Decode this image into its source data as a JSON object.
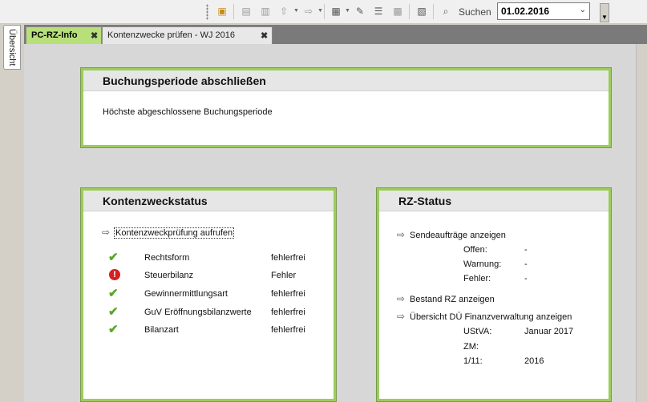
{
  "toolbar": {
    "search_label": "Suchen",
    "date_value": "01.02.2016",
    "icons": [
      "folder-icon",
      "print-preview-icon",
      "print-icon",
      "upload-arrow-icon",
      "forward-arrow-icon",
      "export-icon",
      "wrench-icon",
      "list-indent-icon",
      "stamp-icon",
      "pdf-icon",
      "search-icon"
    ]
  },
  "side_tab": {
    "label": "Übersicht"
  },
  "tabs": [
    {
      "label": "PC-RZ-Info",
      "close": "✖"
    },
    {
      "label": "Kontenzwecke prüfen - WJ 2016",
      "close": "✖"
    }
  ],
  "panels": {
    "buchung": {
      "title": "Buchungsperiode abschließen",
      "text": "Höchste abgeschlossene Buchungsperiode"
    },
    "konten": {
      "title": "Kontenzweckstatus",
      "link": "Kontenzweckprüfung aufrufen",
      "rows": [
        {
          "name": "Rechtsform",
          "status": "fehlerfrei",
          "icon": "check-icon"
        },
        {
          "name": "Steuerbilanz",
          "status": "Fehler",
          "icon": "error-icon"
        },
        {
          "name": "Gewinnermittlungsart",
          "status": "fehlerfrei",
          "icon": "check-icon"
        },
        {
          "name": "GuV Eröffnungsbilanzwerte",
          "status": "fehlerfrei",
          "icon": "check-icon"
        },
        {
          "name": "Bilanzart",
          "status": "fehlerfrei",
          "icon": "check-icon"
        }
      ]
    },
    "rz": {
      "title": "RZ-Status",
      "link_send": "Sendeaufträge anzeigen",
      "send_rows": [
        {
          "label": "Offen:",
          "value": "-"
        },
        {
          "label": "Warnung:",
          "value": "-"
        },
        {
          "label": "Fehler:",
          "value": "-"
        }
      ],
      "link_bestand": "Bestand RZ anzeigen",
      "link_uebersicht": "Übersicht DÜ Finanzverwaltung anzeigen",
      "fv_rows": [
        {
          "label": "UStVA:",
          "value": "Januar 2017"
        },
        {
          "label": "ZM:",
          "value": ""
        },
        {
          "label": "1/11:",
          "value": "2016"
        }
      ]
    }
  },
  "colors": {
    "accent_green": "#9ccc5a",
    "check_green": "#5aa52a",
    "error_red": "#d32020"
  }
}
